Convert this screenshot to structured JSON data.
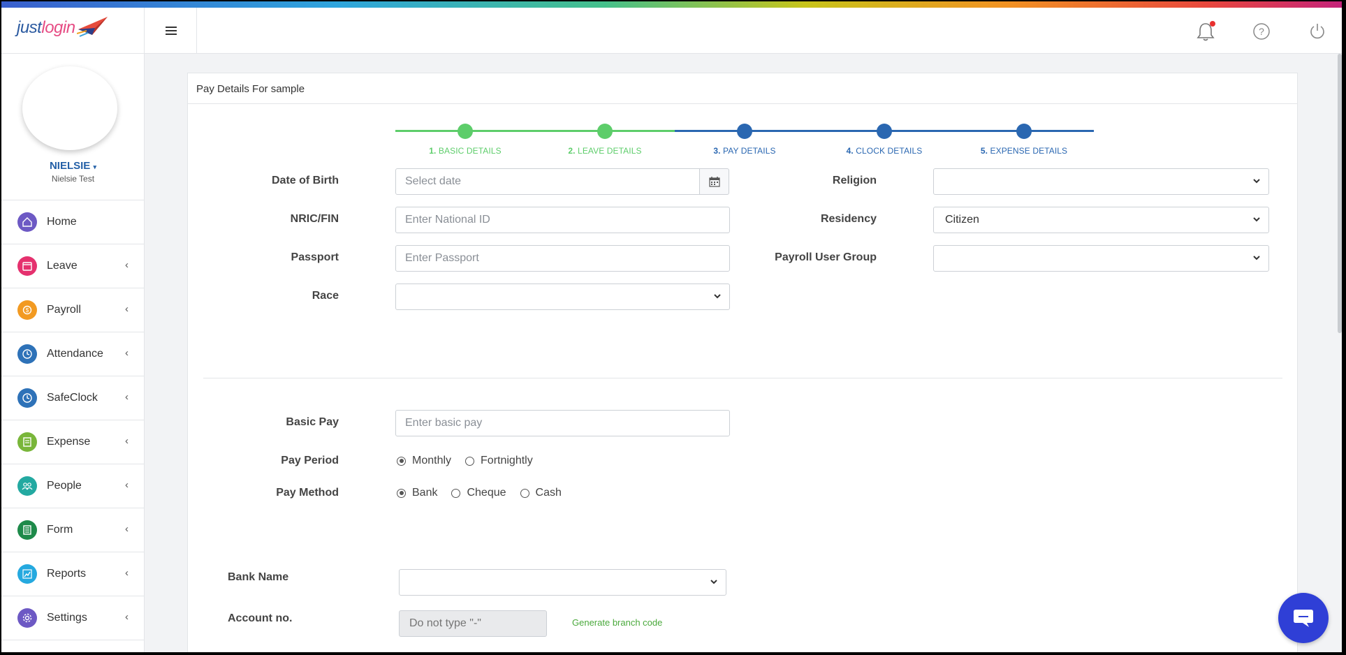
{
  "brand": {
    "logo_text_a": "just",
    "logo_text_b": "login"
  },
  "header": {
    "menu_icon": "hamburger-icon",
    "icons": [
      "bell-icon",
      "help-icon",
      "power-icon"
    ]
  },
  "user": {
    "name": "NIELSIE",
    "caret": "▾",
    "subtitle": "Nielsie Test"
  },
  "sidebar": {
    "items": [
      {
        "label": "Home",
        "icon": "home-icon",
        "color": "#6d59c4",
        "has_arrow": false
      },
      {
        "label": "Leave",
        "icon": "leave-icon",
        "color": "#e5316e",
        "has_arrow": true
      },
      {
        "label": "Payroll",
        "icon": "payroll-icon",
        "color": "#f29a22",
        "has_arrow": true
      },
      {
        "label": "Attendance",
        "icon": "clock-icon",
        "color": "#2e72b8",
        "has_arrow": true
      },
      {
        "label": "SafeClock",
        "icon": "clock-icon",
        "color": "#2e72b8",
        "has_arrow": true
      },
      {
        "label": "Expense",
        "icon": "expense-icon",
        "color": "#79b63a",
        "has_arrow": true
      },
      {
        "label": "People",
        "icon": "people-icon",
        "color": "#23a9a1",
        "has_arrow": true
      },
      {
        "label": "Form",
        "icon": "form-icon",
        "color": "#1e8a4a",
        "has_arrow": true
      },
      {
        "label": "Reports",
        "icon": "reports-icon",
        "color": "#25a9df",
        "has_arrow": true
      },
      {
        "label": "Settings",
        "icon": "gear-icon",
        "color": "#6d59c4",
        "has_arrow": true
      }
    ],
    "arrow": "‹"
  },
  "card": {
    "title": "Pay Details For  sample"
  },
  "steps": [
    {
      "num": "1.",
      "label": " BASIC DETAILS",
      "state": "done"
    },
    {
      "num": "2.",
      "label": " LEAVE DETAILS",
      "state": "done"
    },
    {
      "num": "3.",
      "label": " PAY DETAILS",
      "state": "current"
    },
    {
      "num": "4.",
      "label": " CLOCK DETAILS",
      "state": "current"
    },
    {
      "num": "5.",
      "label": " EXPENSE DETAILS",
      "state": "current"
    }
  ],
  "colors": {
    "done": "#5dcd6a",
    "current": "#2a67b1"
  },
  "form": {
    "dob_label": "Date of Birth",
    "dob_placeholder": "Select date",
    "nric_label": "NRIC/FIN",
    "nric_placeholder": "Enter National ID",
    "passport_label": "Passport",
    "passport_placeholder": "Enter Passport",
    "race_label": "Race",
    "race_value": "",
    "religion_label": "Religion",
    "religion_value": "",
    "residency_label": "Residency",
    "residency_value": "Citizen",
    "payroll_group_label": "Payroll User Group",
    "payroll_group_value": "",
    "basic_pay_label": "Basic Pay",
    "basic_pay_placeholder": "Enter basic pay",
    "pay_period_label": "Pay Period",
    "pay_period_options": [
      "Monthly",
      "Fortnightly"
    ],
    "pay_period_selected": "Monthly",
    "pay_method_label": "Pay Method",
    "pay_method_options": [
      "Bank",
      "Cheque",
      "Cash"
    ],
    "pay_method_selected": "Bank",
    "bank_name_label": "Bank Name",
    "bank_name_value": "",
    "account_label": "Account no.",
    "account_placeholder": "Do not type \"-\"",
    "generate_link": "Generate branch code"
  }
}
